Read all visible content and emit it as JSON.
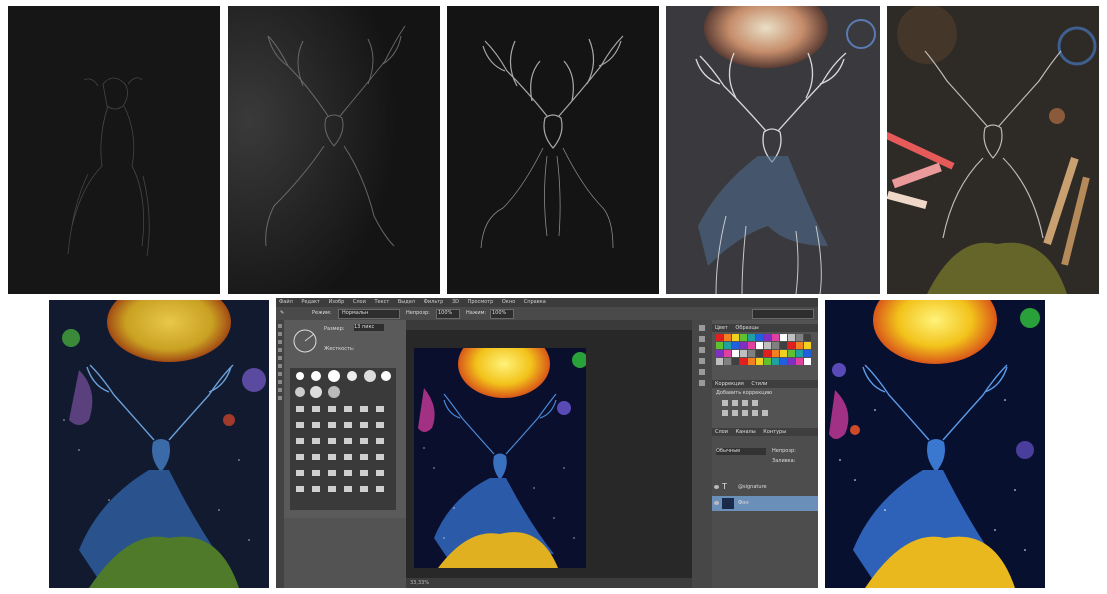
{
  "collage": {
    "description_steps": [
      "sketch-1",
      "sketch-2",
      "sketch-3",
      "sketch-4",
      "sketch-5-with-pencils",
      "colored",
      "photoshop-editing",
      "final"
    ]
  },
  "colors": {
    "paper_black": "#121212",
    "chalk": "#cfcfcf",
    "sun_yellow": "#f2c21a",
    "sun_orange": "#d9561a",
    "deer_blue": "#3f79b8",
    "night_sky": "#0a0f2e",
    "flower_gold": "#d8a21a",
    "ps_panel": "#535353",
    "ps_selected_layer": "#6a8fb8"
  },
  "photoshop": {
    "menu": [
      "Файл",
      "Редакт",
      "Изобр",
      "Слои",
      "Текст",
      "Выдел",
      "Фильтр",
      "3D",
      "Просмотр",
      "Окно",
      "Справка"
    ],
    "options": {
      "mode_label": "Режим:",
      "mode_value": "Нормальн",
      "opacity_label": "Непрозр:",
      "opacity_value": "100%",
      "flow_label": "Нажим:",
      "flow_value": "100%"
    },
    "brush": {
      "size_label": "Размер:",
      "size_value": "13 пикс",
      "hardness_label": "Жесткость:"
    },
    "panel_tabs": {
      "swatches": [
        "Цвет",
        "Образцы"
      ],
      "adjust": [
        "Коррекция",
        "Стили"
      ],
      "layers": [
        "Слои",
        "Каналы",
        "Контуры"
      ]
    },
    "adjust_title": "Добавить коррекцию",
    "layers_mode": "Обычные",
    "layers_opacity_label": "Непрозр:",
    "layers_fill_label": "Заливка:",
    "layers": [
      {
        "name": "@signature",
        "type": "text"
      },
      {
        "name": "Фон",
        "type": "image"
      }
    ],
    "status": "33,33%"
  }
}
